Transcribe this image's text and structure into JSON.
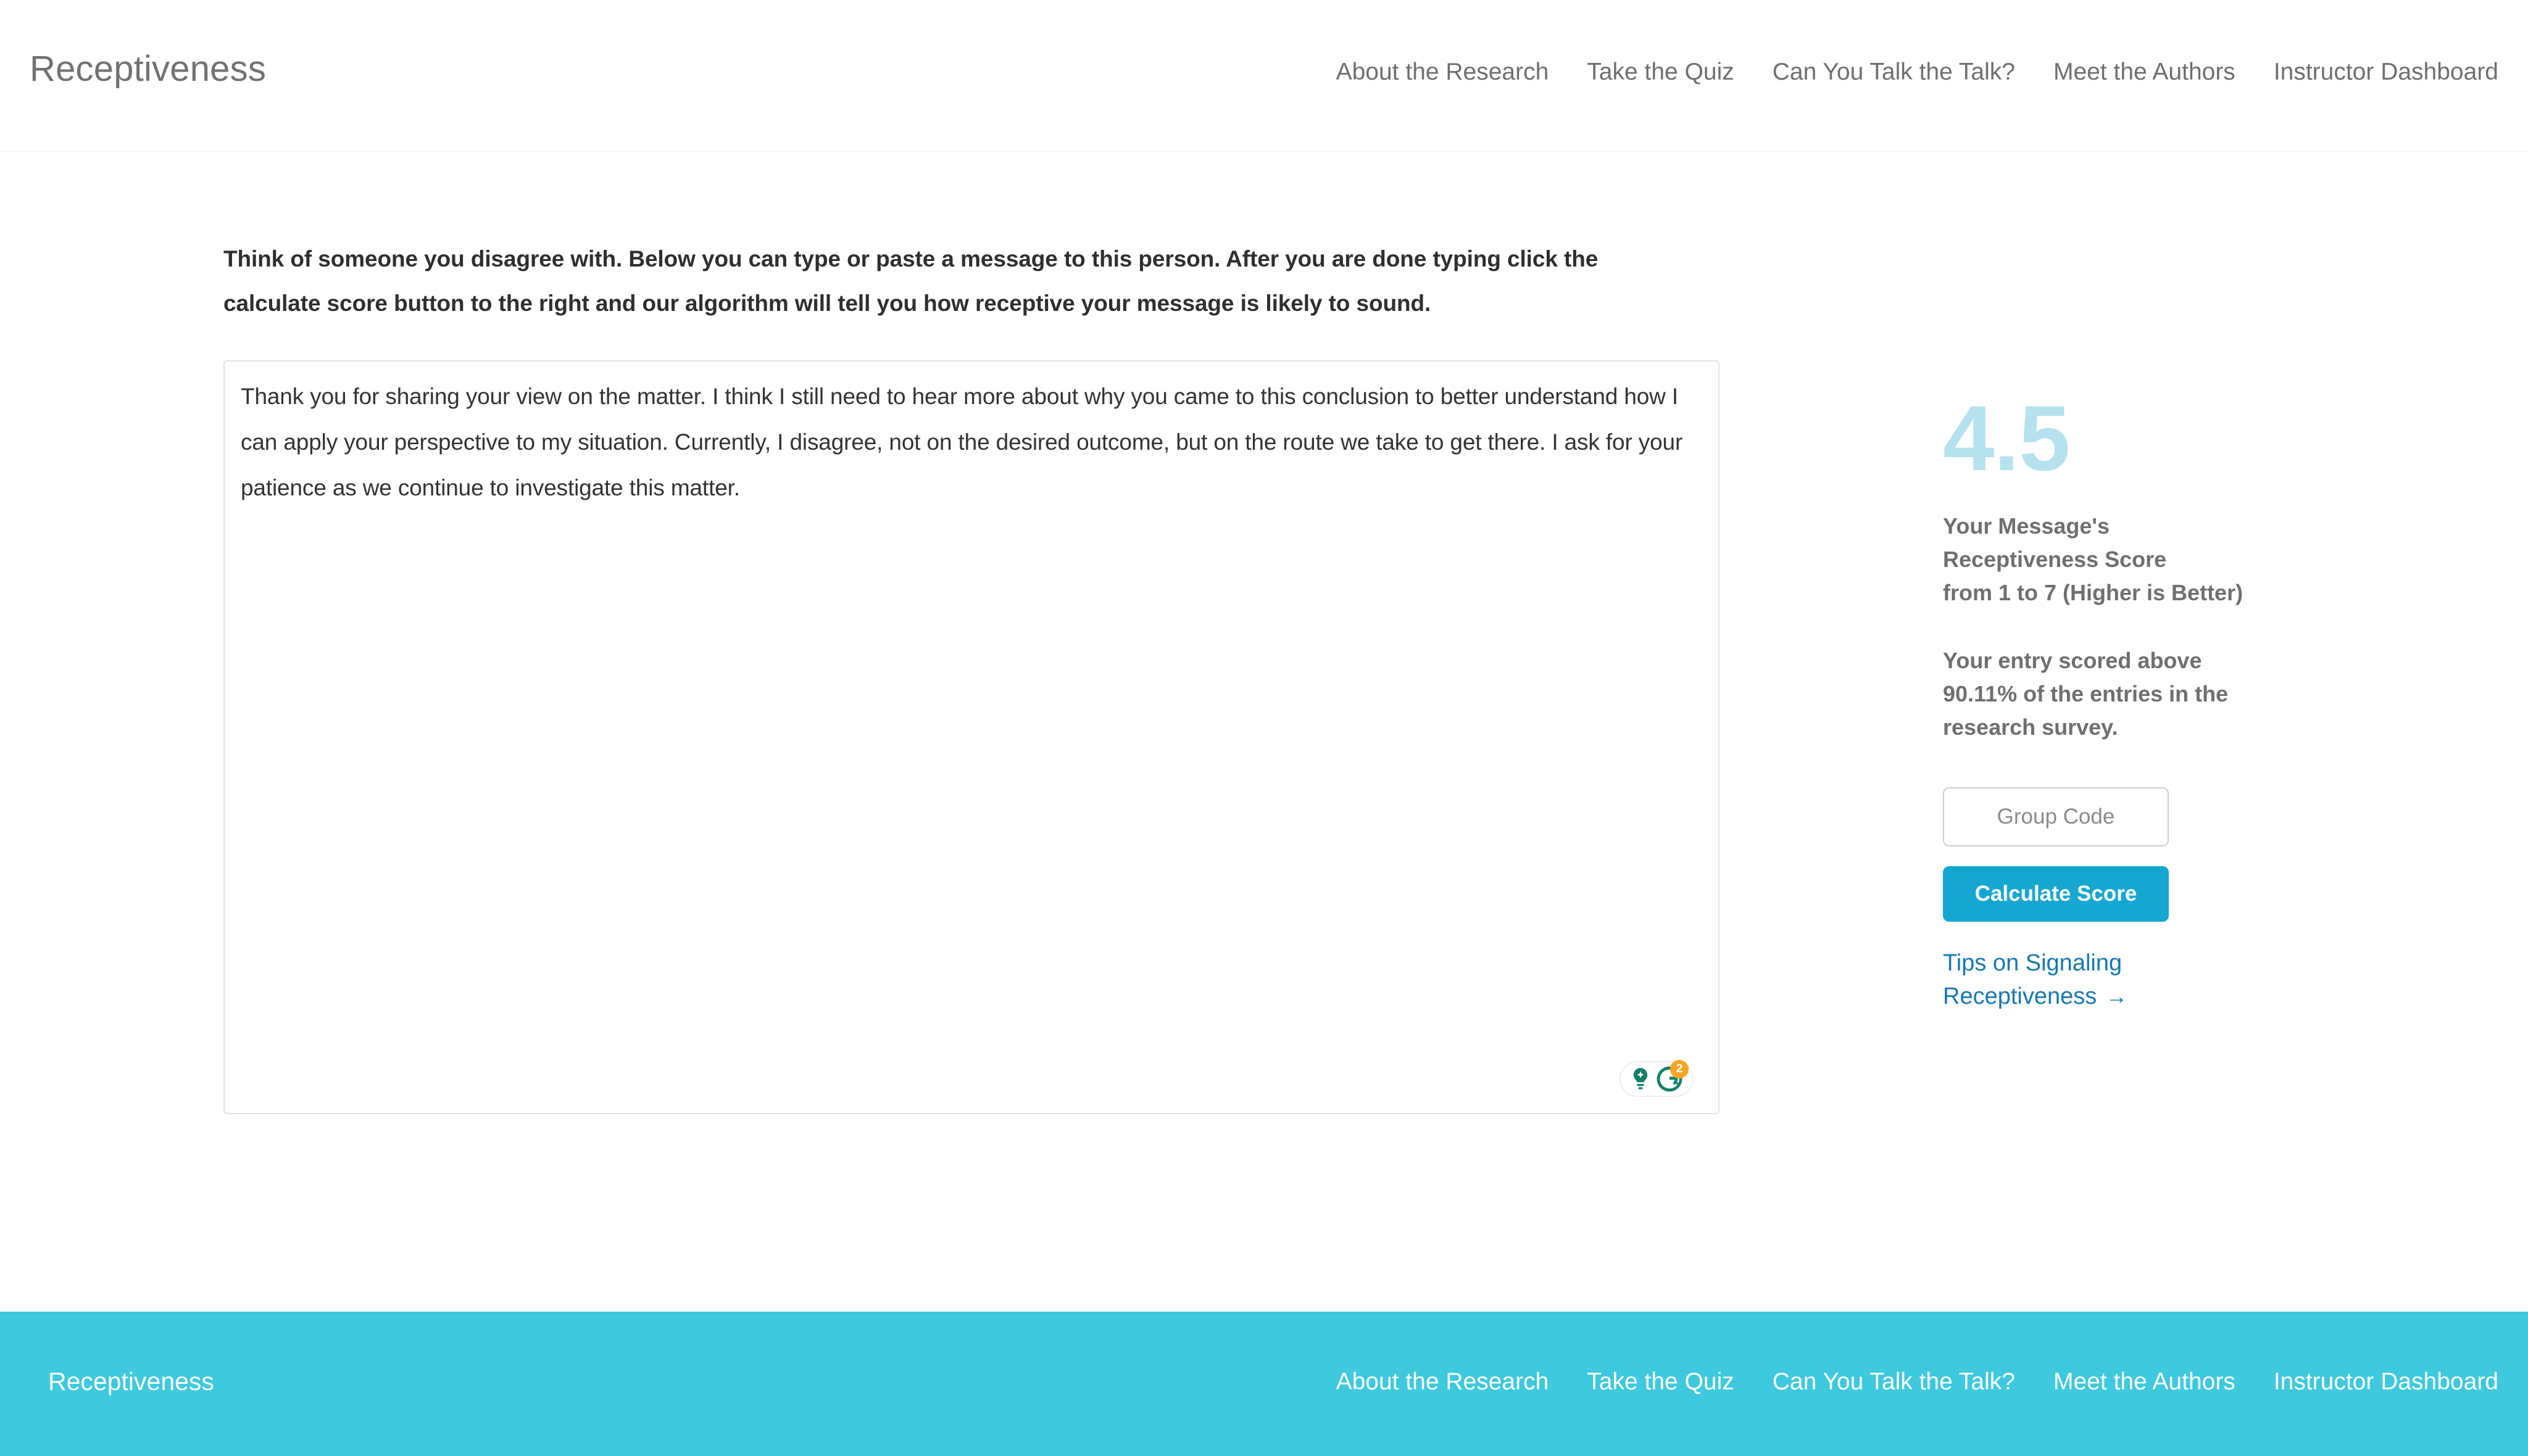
{
  "header": {
    "brand": "Receptiveness",
    "nav": [
      {
        "label": "About the Research"
      },
      {
        "label": "Take the Quiz"
      },
      {
        "label": "Can You Talk the Talk?"
      },
      {
        "label": "Meet the Authors"
      },
      {
        "label": "Instructor Dashboard"
      }
    ]
  },
  "main": {
    "instructions": "Think of someone you disagree with. Below you can type or paste a message to this person. After you are done typing click the calculate score button to the right and our algorithm will tell you how receptive your message is likely to sound.",
    "editor": {
      "value": "Thank you for sharing your view on the matter. I think I still need to hear more about why you came to this conclusion to better understand how I can apply your perspective to my situation. Currently, I disagree, not on the desired outcome, but on the route we take to get there. I ask for your patience as we continue to investigate this matter.",
      "placeholder": ""
    },
    "grammarly": {
      "badge_count": "2",
      "bulb_icon": "lightbulb-icon",
      "logo_icon": "grammarly-logo-icon"
    }
  },
  "score_panel": {
    "value": "4.5",
    "caption_line1": "Your Message's",
    "caption_line2": "Receptiveness Score",
    "caption_line3": "from 1 to 7 (Higher is Better)",
    "percentile_line1": "Your entry scored above",
    "percentile_line2": "90.11% of the entries in the",
    "percentile_line3": "research survey.",
    "group_code_placeholder": "Group Code",
    "group_code_value": "",
    "calculate_label": "Calculate Score",
    "tips_line1": "Tips on Signaling",
    "tips_line2": "Receptiveness",
    "tips_arrow": "→"
  },
  "footer": {
    "brand": "Receptiveness",
    "nav": [
      {
        "label": "About the Research"
      },
      {
        "label": "Take the Quiz"
      },
      {
        "label": "Can You Talk the Talk?"
      },
      {
        "label": "Meet the Authors"
      },
      {
        "label": "Instructor Dashboard"
      }
    ]
  },
  "colors": {
    "footer_bg": "#3ec9de",
    "button_bg": "#16a7d0",
    "score_color": "#b6e1ef",
    "link_color": "#1878b0",
    "text_gray": "#6f6f6f",
    "badge_orange": "#f5a623",
    "grammarly_green": "#15806a"
  }
}
